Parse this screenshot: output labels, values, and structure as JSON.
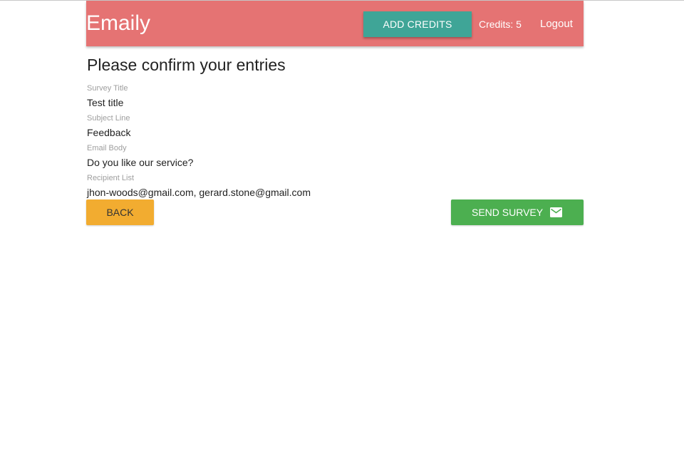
{
  "navbar": {
    "brand": "Emaily",
    "add_credits_label": "ADD CREDITS",
    "credits_text": "Credits: 5",
    "logout_label": "Logout",
    "bg_color": "#e57373",
    "add_credits_color": "#3fa597"
  },
  "review": {
    "title": "Please confirm your entries",
    "fields": [
      {
        "label": "Survey Title",
        "value": "Test title"
      },
      {
        "label": "Subject Line",
        "value": "Feedback"
      },
      {
        "label": "Email Body",
        "value": "Do you like our service?"
      },
      {
        "label": "Recipient List",
        "value": "jhon-woods@gmail.com, gerard.stone@gmail.com"
      }
    ]
  },
  "actions": {
    "back_label": "BACK",
    "back_color": "#f2ac30",
    "send_label": "SEND SURVEY",
    "send_icon": "email-icon",
    "send_color": "#4caf50"
  }
}
